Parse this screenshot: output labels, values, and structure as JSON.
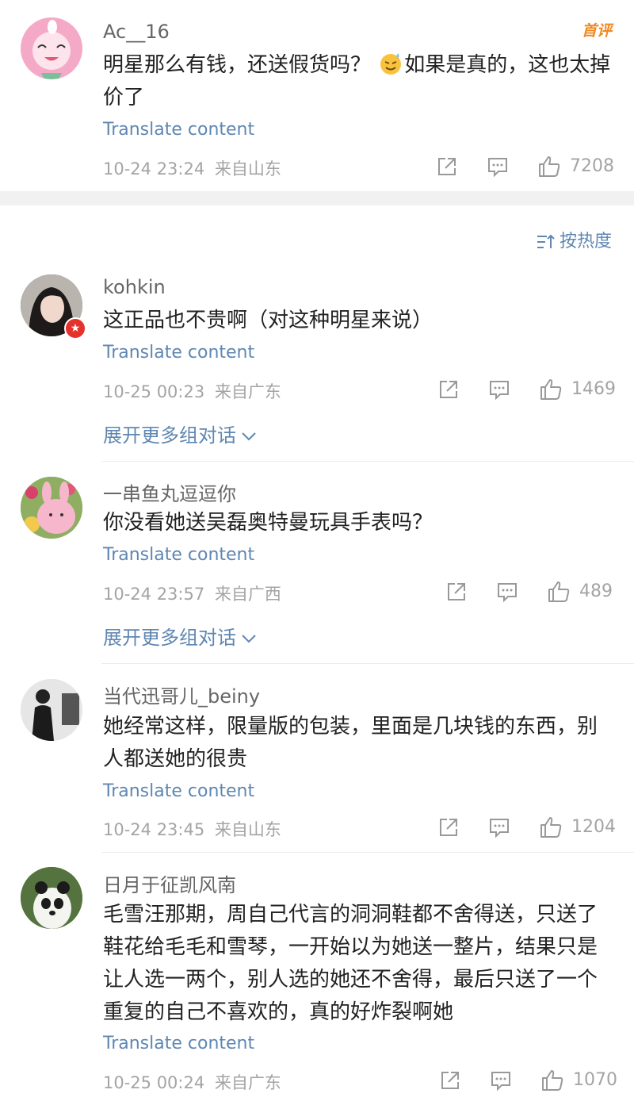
{
  "sort_label": "按热度",
  "icons": {
    "share": "share-icon",
    "comment": "comment-icon",
    "like": "thumbs-up-icon",
    "sort": "sort-icon",
    "chevron": "chevron-down-icon"
  },
  "colors": {
    "link": "#5f87b2",
    "meta": "#a4a4a4",
    "badge": "#f08a24"
  },
  "top_comment": {
    "username": "Ac__16",
    "badge": "首评",
    "text_before_emoji": "明星那么有钱，还送假货吗？ ",
    "emoji": "smile-sweat-emoji",
    "text_after_emoji": "如果是真的，这也太掉价了",
    "translate": "Translate content",
    "time": "10-24 23:24",
    "location": "来自山东",
    "likes": "7208"
  },
  "comments": [
    {
      "username": "kohkin",
      "text": "这正品也不贵啊（对这种明星来说）",
      "translate": "Translate content",
      "time": "10-25 00:23",
      "location": "来自广东",
      "likes": "1469",
      "expand": "展开更多组对话"
    },
    {
      "username": "一串鱼丸逗逗你",
      "text": "你没看她送吴磊奥特曼玩具手表吗？",
      "translate": "Translate content",
      "time": "10-24 23:57",
      "location": "来自广西",
      "likes": "489",
      "expand": "展开更多组对话"
    },
    {
      "username": "当代迅哥儿_beiny",
      "text": "她经常这样，限量版的包装，里面是几块钱的东西，别人都送她的很贵",
      "translate": "Translate content",
      "time": "10-24 23:45",
      "location": "来自山东",
      "likes": "1204"
    },
    {
      "username": "日月于征凯风南",
      "text": "毛雪汪那期，周自己代言的洞洞鞋都不舍得送，只送了鞋花给毛毛和雪琴，一开始以为她送一整片，结果只是让人选一两个，别人选的她还不舍得，最后只送了一个重复的自己不喜欢的，真的好炸裂啊她",
      "translate": "Translate content",
      "time": "10-25 00:24",
      "location": "来自广东",
      "likes": "1070"
    }
  ]
}
